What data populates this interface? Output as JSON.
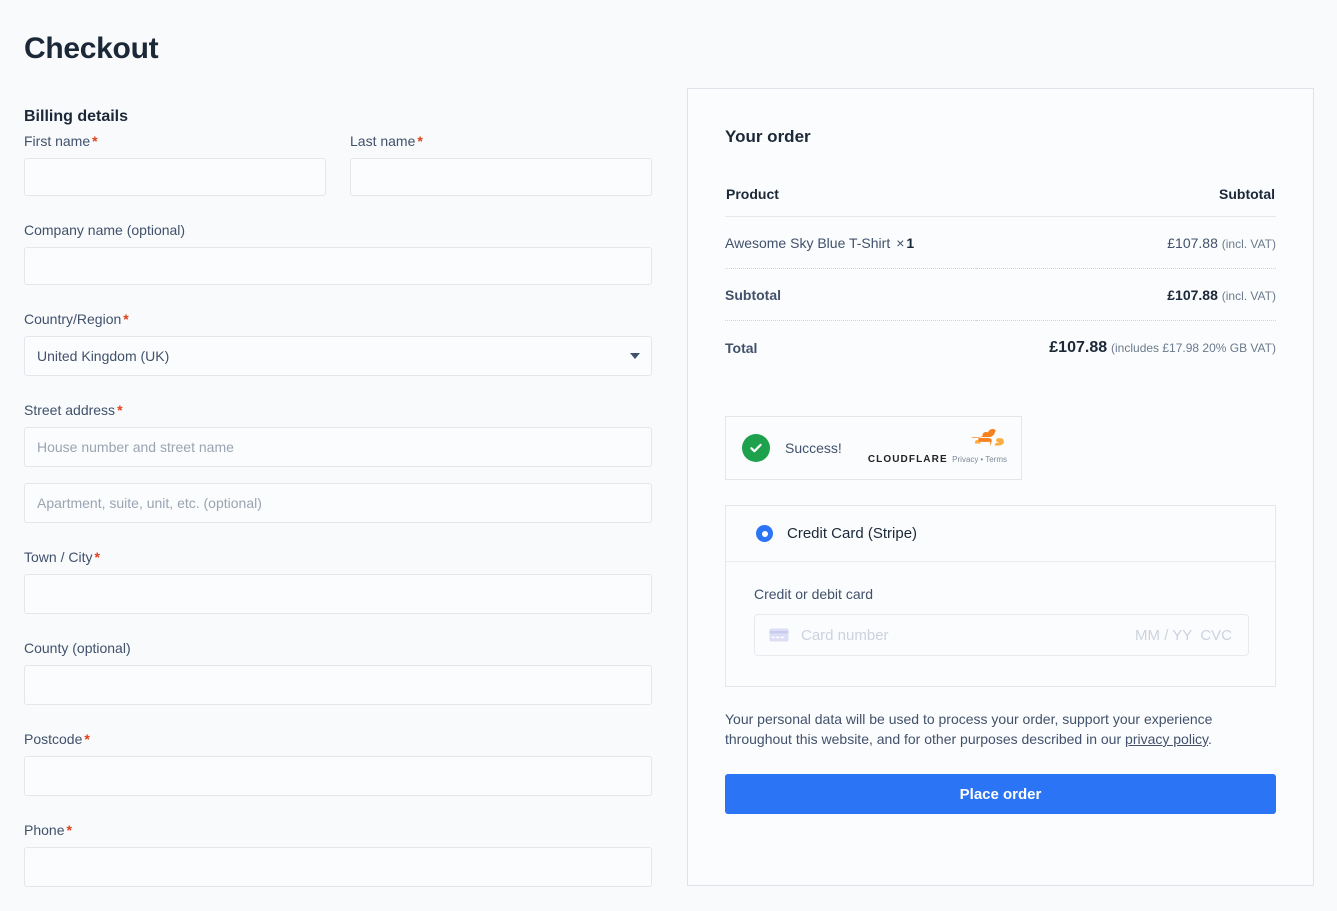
{
  "page": {
    "title": "Checkout"
  },
  "billing": {
    "section_title": "Billing details",
    "required_marker": "*",
    "fields": [
      {
        "label": "First name",
        "required": true,
        "value": "",
        "placeholder": ""
      },
      {
        "label": "Last name",
        "required": true,
        "value": "",
        "placeholder": ""
      },
      {
        "label": "Company name (optional)",
        "required": false,
        "value": "",
        "placeholder": ""
      },
      {
        "label": "Country/Region",
        "required": true,
        "value": "United Kingdom (UK)",
        "placeholder": ""
      },
      {
        "label": "Street address",
        "required": true,
        "value": "",
        "placeholder": "House number and street name"
      },
      {
        "label": "",
        "required": false,
        "value": "",
        "placeholder": "Apartment, suite, unit, etc. (optional)"
      },
      {
        "label": "Town / City",
        "required": true,
        "value": "",
        "placeholder": ""
      },
      {
        "label": "County (optional)",
        "required": false,
        "value": "",
        "placeholder": ""
      },
      {
        "label": "Postcode",
        "required": true,
        "value": "",
        "placeholder": ""
      },
      {
        "label": "Phone",
        "required": true,
        "value": "",
        "placeholder": ""
      }
    ]
  },
  "order": {
    "title": "Your order",
    "columns": {
      "product": "Product",
      "subtotal": "Subtotal"
    },
    "items": [
      {
        "name": "Awesome Sky Blue T-Shirt",
        "qty_symbol": "×",
        "qty": "1",
        "amount": "£107.88",
        "note": "(incl. VAT)"
      }
    ],
    "subtotal": {
      "label": "Subtotal",
      "amount": "£107.88",
      "note": "(incl. VAT)"
    },
    "total": {
      "label": "Total",
      "amount": "£107.88",
      "note": "(includes £17.98 20% GB VAT)"
    }
  },
  "turnstile": {
    "status": "Success!",
    "brand": "CLOUDFLARE",
    "privacy_link": "Privacy",
    "separator": "•",
    "terms_link": "Terms",
    "success_color": "#1da14c",
    "brand_color": "#f6821f"
  },
  "payment": {
    "method_label": "Credit Card (Stripe)",
    "selected": true,
    "card_section_label": "Credit or debit card",
    "card_placeholder": "Card number",
    "card_expiry_cvc": "MM / YY  CVC",
    "radio_color": "#2b74f5"
  },
  "footer": {
    "privacy_text_before": "Your personal data will be used to process your order, support your experience throughout this website, and for other purposes described in our ",
    "privacy_link_text": "privacy policy",
    "privacy_text_after": ".",
    "place_order_label": "Place order",
    "button_color": "#2b74f5"
  }
}
